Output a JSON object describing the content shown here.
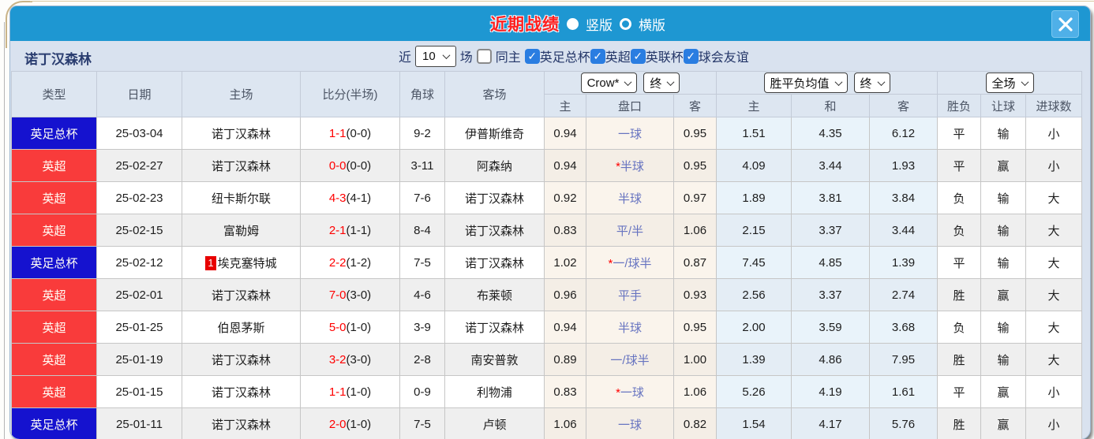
{
  "dialog": {
    "title": "近期战绩",
    "view_options": [
      {
        "label": "竖版",
        "selected": true
      },
      {
        "label": "横版",
        "selected": false
      }
    ]
  },
  "filter": {
    "team": "诺丁汉森林",
    "recent_label": "近",
    "recent_count": "10",
    "unit_label": "场",
    "same_home": {
      "label": "同主",
      "checked": false
    },
    "leagues": [
      {
        "label": "英足总杯",
        "checked": true
      },
      {
        "label": "英超",
        "checked": true
      },
      {
        "label": "英联杯",
        "checked": true
      },
      {
        "label": "球会友谊",
        "checked": true
      }
    ]
  },
  "table": {
    "dropdowns": {
      "bookmaker": "Crow*",
      "bookmaker_period": "终",
      "average": "胜平负均值",
      "average_period": "终",
      "scope": "全场"
    },
    "columns": [
      "类型",
      "日期",
      "主场",
      "比分(半场)",
      "角球",
      "客场",
      "主",
      "盘口",
      "客",
      "主",
      "和",
      "客",
      "胜负",
      "让球",
      "进球数"
    ],
    "rows": [
      {
        "league": "英足总杯",
        "league_color": "blue",
        "date": "25-03-04",
        "home": "诺丁汉森林",
        "home_self": true,
        "home_badge": "",
        "score": "1-1",
        "half": "(0-0)",
        "corners": "9-2",
        "away": "伊普斯维奇",
        "away_self": false,
        "home_odds": "0.94",
        "handicap": "一球",
        "handicap_star": false,
        "away_odds": "0.95",
        "avg_win": "1.51",
        "avg_draw": "4.35",
        "avg_lose": "6.12",
        "result": "平",
        "result_color": "blue",
        "handicap_result": "输",
        "handicap_result_color": "green",
        "goals": "小",
        "goals_color": "green"
      },
      {
        "league": "英超",
        "league_color": "red",
        "date": "25-02-27",
        "home": "诺丁汉森林",
        "home_self": true,
        "home_badge": "",
        "score": "0-0",
        "half": "(0-0)",
        "corners": "3-11",
        "away": "阿森纳",
        "away_self": false,
        "home_odds": "0.94",
        "handicap": "半球",
        "handicap_star": true,
        "away_odds": "0.95",
        "avg_win": "4.09",
        "avg_draw": "3.44",
        "avg_lose": "1.93",
        "result": "平",
        "result_color": "blue",
        "handicap_result": "赢",
        "handicap_result_color": "red",
        "goals": "小",
        "goals_color": "green"
      },
      {
        "league": "英超",
        "league_color": "red",
        "date": "25-02-23",
        "home": "纽卡斯尔联",
        "home_self": false,
        "home_badge": "",
        "score": "4-3",
        "half": "(4-1)",
        "corners": "7-6",
        "away": "诺丁汉森林",
        "away_self": true,
        "home_odds": "0.92",
        "handicap": "半球",
        "handicap_star": false,
        "away_odds": "0.97",
        "avg_win": "1.89",
        "avg_draw": "3.81",
        "avg_lose": "3.84",
        "result": "负",
        "result_color": "green",
        "handicap_result": "输",
        "handicap_result_color": "green",
        "goals": "大",
        "goals_color": "red"
      },
      {
        "league": "英超",
        "league_color": "red",
        "date": "25-02-15",
        "home": "富勒姆",
        "home_self": false,
        "home_badge": "",
        "score": "2-1",
        "half": "(1-1)",
        "corners": "8-4",
        "away": "诺丁汉森林",
        "away_self": true,
        "home_odds": "0.83",
        "handicap": "平/半",
        "handicap_star": false,
        "away_odds": "1.06",
        "avg_win": "2.15",
        "avg_draw": "3.37",
        "avg_lose": "3.44",
        "result": "负",
        "result_color": "green",
        "handicap_result": "输",
        "handicap_result_color": "green",
        "goals": "大",
        "goals_color": "red"
      },
      {
        "league": "英足总杯",
        "league_color": "blue",
        "date": "25-02-12",
        "home": "埃克塞特城",
        "home_self": false,
        "home_badge": "1",
        "score": "2-2",
        "half": "(1-2)",
        "corners": "7-5",
        "away": "诺丁汉森林",
        "away_self": true,
        "home_odds": "1.02",
        "handicap": "一/球半",
        "handicap_star": true,
        "away_odds": "0.87",
        "avg_win": "7.45",
        "avg_draw": "4.85",
        "avg_lose": "1.39",
        "result": "平",
        "result_color": "blue",
        "handicap_result": "输",
        "handicap_result_color": "green",
        "goals": "大",
        "goals_color": "red"
      },
      {
        "league": "英超",
        "league_color": "red",
        "date": "25-02-01",
        "home": "诺丁汉森林",
        "home_self": true,
        "home_badge": "",
        "score": "7-0",
        "half": "(3-0)",
        "corners": "4-6",
        "away": "布莱顿",
        "away_self": false,
        "home_odds": "0.96",
        "handicap": "平手",
        "handicap_star": false,
        "away_odds": "0.93",
        "avg_win": "2.56",
        "avg_draw": "3.37",
        "avg_lose": "2.74",
        "result": "胜",
        "result_color": "red",
        "handicap_result": "赢",
        "handicap_result_color": "red",
        "goals": "大",
        "goals_color": "red"
      },
      {
        "league": "英超",
        "league_color": "red",
        "date": "25-01-25",
        "home": "伯恩茅斯",
        "home_self": false,
        "home_badge": "",
        "score": "5-0",
        "half": "(1-0)",
        "corners": "3-9",
        "away": "诺丁汉森林",
        "away_self": true,
        "home_odds": "0.94",
        "handicap": "半球",
        "handicap_star": false,
        "away_odds": "0.95",
        "avg_win": "2.00",
        "avg_draw": "3.59",
        "avg_lose": "3.68",
        "result": "负",
        "result_color": "green",
        "handicap_result": "输",
        "handicap_result_color": "green",
        "goals": "大",
        "goals_color": "red"
      },
      {
        "league": "英超",
        "league_color": "red",
        "date": "25-01-19",
        "home": "诺丁汉森林",
        "home_self": true,
        "home_badge": "",
        "score": "3-2",
        "half": "(3-0)",
        "corners": "2-8",
        "away": "南安普敦",
        "away_self": false,
        "home_odds": "0.89",
        "handicap": "一/球半",
        "handicap_star": false,
        "away_odds": "1.00",
        "avg_win": "1.39",
        "avg_draw": "4.86",
        "avg_lose": "7.95",
        "result": "胜",
        "result_color": "red",
        "handicap_result": "输",
        "handicap_result_color": "green",
        "goals": "大",
        "goals_color": "red"
      },
      {
        "league": "英超",
        "league_color": "red",
        "date": "25-01-15",
        "home": "诺丁汉森林",
        "home_self": true,
        "home_badge": "",
        "score": "1-1",
        "half": "(1-0)",
        "corners": "0-9",
        "away": "利物浦",
        "away_self": false,
        "home_odds": "0.83",
        "handicap": "一球",
        "handicap_star": true,
        "away_odds": "1.06",
        "avg_win": "5.26",
        "avg_draw": "4.19",
        "avg_lose": "1.61",
        "result": "平",
        "result_color": "blue",
        "handicap_result": "赢",
        "handicap_result_color": "red",
        "goals": "小",
        "goals_color": "green"
      },
      {
        "league": "英足总杯",
        "league_color": "blue",
        "date": "25-01-11",
        "home": "诺丁汉森林",
        "home_self": true,
        "home_badge": "",
        "score": "2-0",
        "half": "(1-0)",
        "corners": "7-5",
        "away": "卢顿",
        "away_self": false,
        "home_odds": "1.06",
        "handicap": "一球",
        "handicap_star": false,
        "away_odds": "0.82",
        "avg_win": "1.54",
        "avg_draw": "4.17",
        "avg_lose": "5.76",
        "result": "胜",
        "result_color": "red",
        "handicap_result": "赢",
        "handicap_result_color": "red",
        "goals": "小",
        "goals_color": "green"
      }
    ]
  },
  "colors": {
    "titlebar_blue": "#1e97d2",
    "badge_red": "#f93b3b",
    "badge_blue": "#1512cf",
    "self_team_green": "#2e9b2e",
    "status_red": "#f0423c",
    "status_green": "#2e9b2e",
    "status_blue": "#4643e8",
    "score_red": "#ff0000",
    "handicap_purple": "#6673c0",
    "avg_draw_blue": "#2b6cb8",
    "checkbox_blue": "#2a7de1"
  }
}
